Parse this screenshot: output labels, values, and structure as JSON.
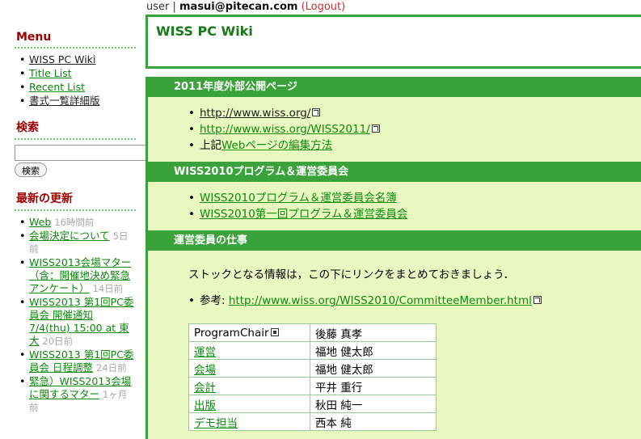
{
  "userbar": {
    "prefix": "user | ",
    "email": "masui@pitecan.com",
    "logout": "(Logout)"
  },
  "sidebar": {
    "menu_title": "Menu",
    "menu_items": [
      {
        "label": "WISS PC Wiki",
        "visited": true
      },
      {
        "label": "Title List",
        "visited": false
      },
      {
        "label": "Recent List",
        "visited": false
      },
      {
        "label": "書式一覧詳細版",
        "visited": true
      }
    ],
    "search_title": "検索",
    "search_value": "",
    "search_button": "検索",
    "recent_title": "最新の更新",
    "recent_items": [
      {
        "label": "Web",
        "ago": "16時間前"
      },
      {
        "label": "会場決定について",
        "ago": "5日前"
      },
      {
        "label": "WISS2013会場マター（含：開催地決め緊急アンケート）",
        "ago": "14日前"
      },
      {
        "label": "WISS2013 第1回PC委員会 開催通知 7/4(thu) 15:00 at 東大",
        "ago": "20日前"
      },
      {
        "label": "WISS2013 第1回PC委員会 日程調整",
        "ago": "24日前"
      },
      {
        "label": "緊急）WISS2013会場に関するマター",
        "ago": "1ヶ月前"
      }
    ]
  },
  "main": {
    "title": "WISS PC Wiki",
    "sections": [
      {
        "heading": "2011年度外部公開ページ",
        "items": [
          {
            "prefix": "",
            "link": "http://www.wiss.org/",
            "visited": true,
            "ext": true
          },
          {
            "prefix": "",
            "link": "http://www.wiss.org/WISS2011/",
            "visited": false,
            "ext": true
          },
          {
            "prefix": "上記",
            "link": "Webページの編集方法",
            "visited": false,
            "ext": false
          }
        ]
      },
      {
        "heading": "WISS2010プログラム＆運営委員会",
        "items": [
          {
            "prefix": "",
            "link": "WISS2010プログラム＆運営委員会名簿",
            "visited": false,
            "ext": false
          },
          {
            "prefix": "",
            "link": "WISS2010第一回プログラム＆運営委員会",
            "visited": false,
            "ext": false
          }
        ]
      }
    ],
    "duties": {
      "heading": "運営委員の仕事",
      "intro": "ストックとなる情報は，この下にリンクをまとめておきましょう．",
      "ref_prefix": "参考: ",
      "ref_link": "http://www.wiss.org/WISS2010/CommitteeMember.html",
      "roles": [
        {
          "role": "ProgramChair",
          "name": "後藤 真孝",
          "link": false
        },
        {
          "role": "運営",
          "name": "福地 健太郎",
          "link": true
        },
        {
          "role": "会場",
          "name": "福地 健太郎",
          "link": true
        },
        {
          "role": "会計",
          "name": "平井 重行",
          "link": true
        },
        {
          "role": "出版",
          "name": "秋田 純一",
          "link": true
        },
        {
          "role": "デモ担当",
          "name": "西本 純",
          "link": true
        }
      ]
    }
  },
  "colors": {
    "accent": "#3aa23a",
    "content_bg": "#e8f8c0",
    "link": "#0b8a0b",
    "heading_red": "#a00000"
  }
}
